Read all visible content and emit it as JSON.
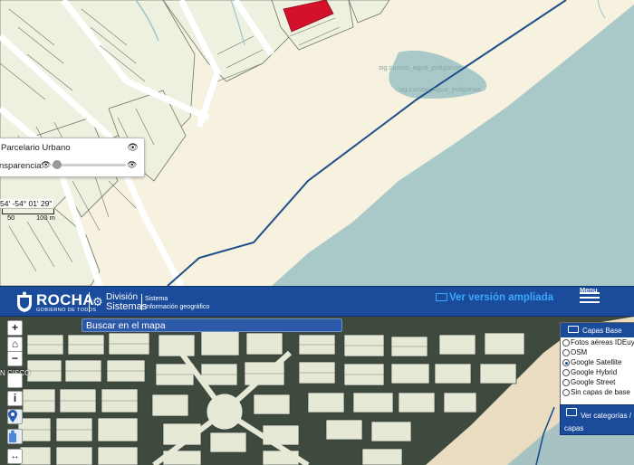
{
  "top_map": {
    "layer_panel": {
      "title": "Parcelario Urbano",
      "transparency_label": "nsparencia:"
    },
    "coordinate_readout": "54' -54° 01' 29\"",
    "scale": {
      "label_50": "50",
      "label_100": "100 m"
    },
    "water_labels": [
      "sig.cursos_agua_poligonos",
      "sig.cursos_agua_poligonos"
    ],
    "colors": {
      "land": "#f7f1df",
      "parcels": "#eef1e0",
      "sea": "#a9c8c8",
      "line": "#1e4f8a",
      "highlight": "#d4112b"
    }
  },
  "header": {
    "logo_text": "ROCHA",
    "logo_subtitle": "GOBIERNO DE TODOS",
    "division_line1": "División",
    "division_line2": "Sistemas",
    "system_line1": "Sistema",
    "system_line2": "Información geográfico",
    "full_version_link": "Ver versión ampliada",
    "menu_label": "Menu",
    "colors": {
      "bar": "#1b4c9c",
      "link": "#3ba7ff"
    }
  },
  "bottom_map": {
    "search_placeholder": "Buscar en el mapa",
    "side_label": "N  CISCO",
    "controls": {
      "zoom_in": "+",
      "zoom_out": "−",
      "info": "i"
    },
    "base_layers": {
      "title": "Capas Base",
      "options": [
        {
          "label": "Fotos aéreas IDEuy",
          "selected": false
        },
        {
          "label": "OSM",
          "selected": false
        },
        {
          "label": "Google Satellite",
          "selected": true
        },
        {
          "label": "Google Hybrid",
          "selected": false
        },
        {
          "label": "Google Street",
          "selected": false
        },
        {
          "label": "Sin capas de base",
          "selected": false
        }
      ]
    },
    "categories": {
      "line1": "Ver categorías /",
      "line2": "capas"
    }
  }
}
